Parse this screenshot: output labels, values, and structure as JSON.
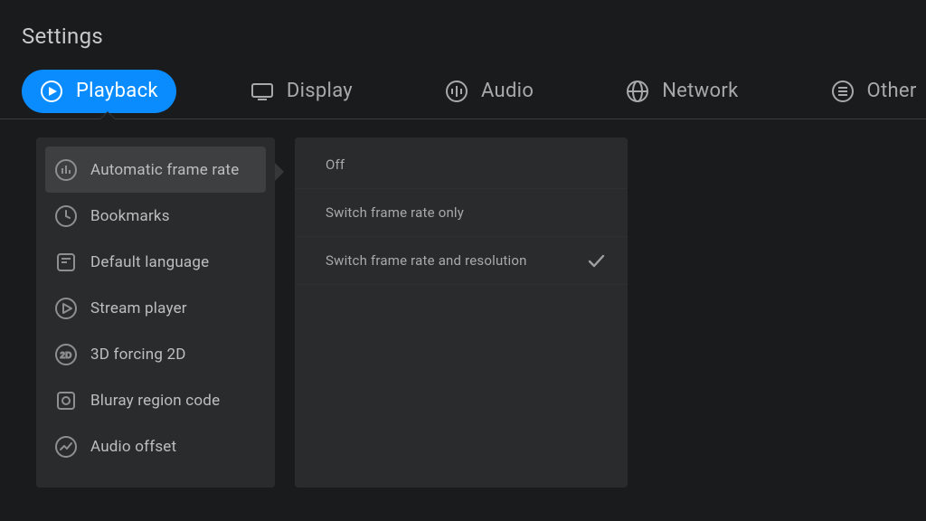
{
  "title": "Settings",
  "tabs": [
    {
      "id": "playback",
      "label": "Playback",
      "active": true
    },
    {
      "id": "display",
      "label": "Display"
    },
    {
      "id": "audio",
      "label": "Audio"
    },
    {
      "id": "network",
      "label": "Network"
    },
    {
      "id": "other",
      "label": "Other"
    }
  ],
  "sidebar": {
    "items": [
      {
        "id": "auto-frame-rate",
        "label": "Automatic frame rate",
        "selected": true
      },
      {
        "id": "bookmarks",
        "label": "Bookmarks"
      },
      {
        "id": "default-language",
        "label": "Default language"
      },
      {
        "id": "stream-player",
        "label": "Stream player"
      },
      {
        "id": "3d-forcing-2d",
        "label": "3D forcing 2D"
      },
      {
        "id": "bluray-region",
        "label": "Bluray region code"
      },
      {
        "id": "audio-offset",
        "label": "Audio offset"
      }
    ]
  },
  "options": {
    "items": [
      {
        "id": "off",
        "label": "Off",
        "checked": false
      },
      {
        "id": "switch-rate",
        "label": "Switch frame rate only",
        "checked": false
      },
      {
        "id": "switch-rate-res",
        "label": "Switch frame rate and resolution",
        "checked": true
      }
    ]
  }
}
